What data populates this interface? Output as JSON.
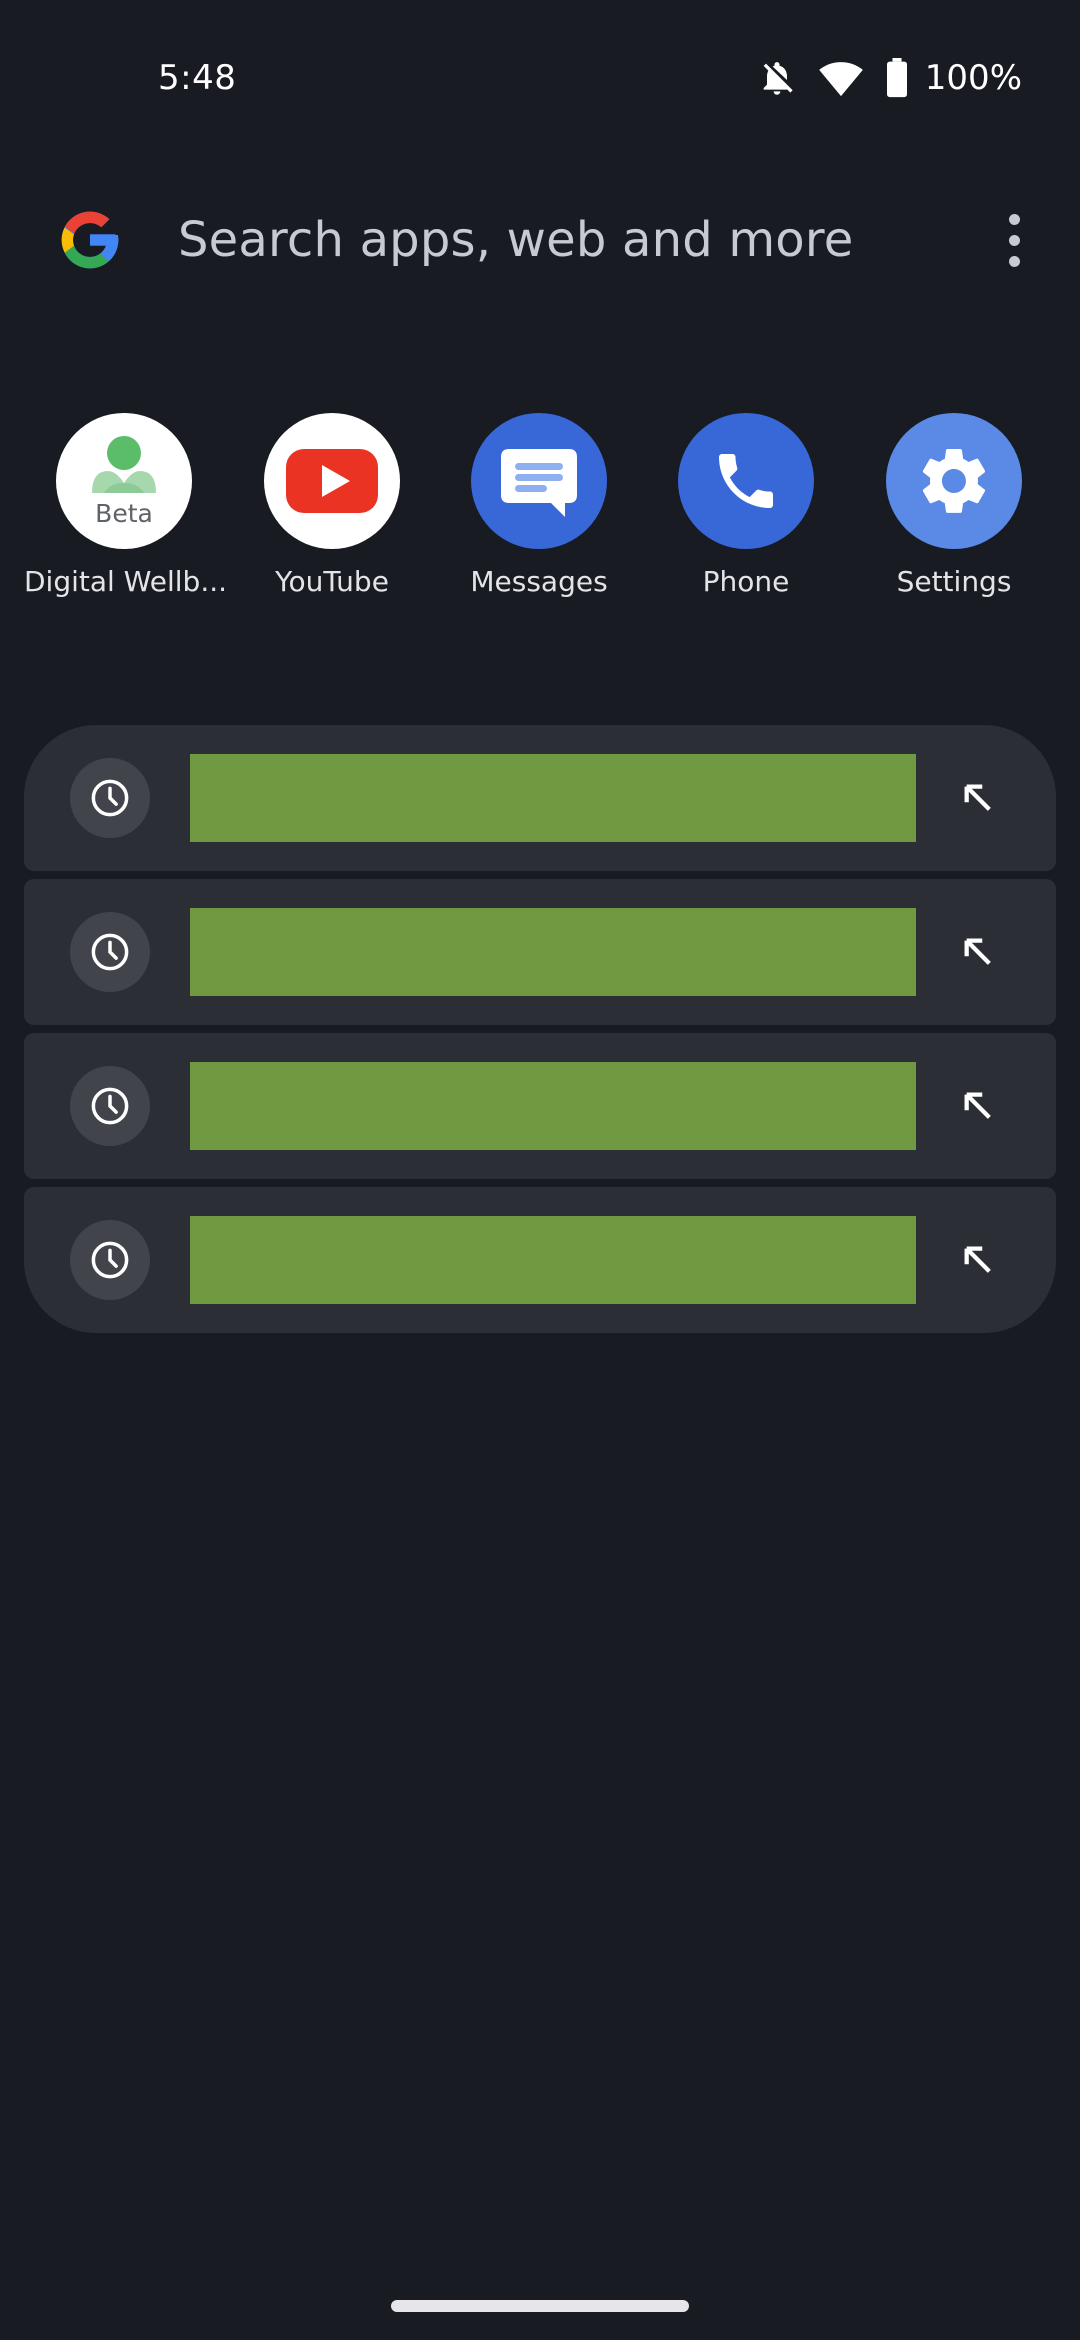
{
  "status_bar": {
    "time": "5:48",
    "battery_percent": "100%",
    "icons": [
      "notifications-off-icon",
      "wifi-icon",
      "battery-icon"
    ]
  },
  "search": {
    "placeholder": "Search apps, web and more",
    "logo": "google-g-logo",
    "menu_icon": "more-vert-icon"
  },
  "apps": [
    {
      "label": "Digital Wellb...",
      "icon": "digital-wellbeing-icon",
      "badge": "Beta"
    },
    {
      "label": "YouTube",
      "icon": "youtube-icon"
    },
    {
      "label": "Messages",
      "icon": "messages-icon"
    },
    {
      "label": "Phone",
      "icon": "phone-icon"
    },
    {
      "label": "Settings",
      "icon": "settings-icon"
    }
  ],
  "suggestions": [
    {
      "icon": "history-icon",
      "action_icon": "fill-query-arrow-icon"
    },
    {
      "icon": "history-icon",
      "action_icon": "fill-query-arrow-icon"
    },
    {
      "icon": "history-icon",
      "action_icon": "fill-query-arrow-icon"
    },
    {
      "icon": "history-icon",
      "action_icon": "fill-query-arrow-icon"
    }
  ],
  "colors": {
    "background": "#191b23",
    "card": "#2c2e36",
    "redaction": "#709a41",
    "accent_blue": "#3868d8"
  }
}
